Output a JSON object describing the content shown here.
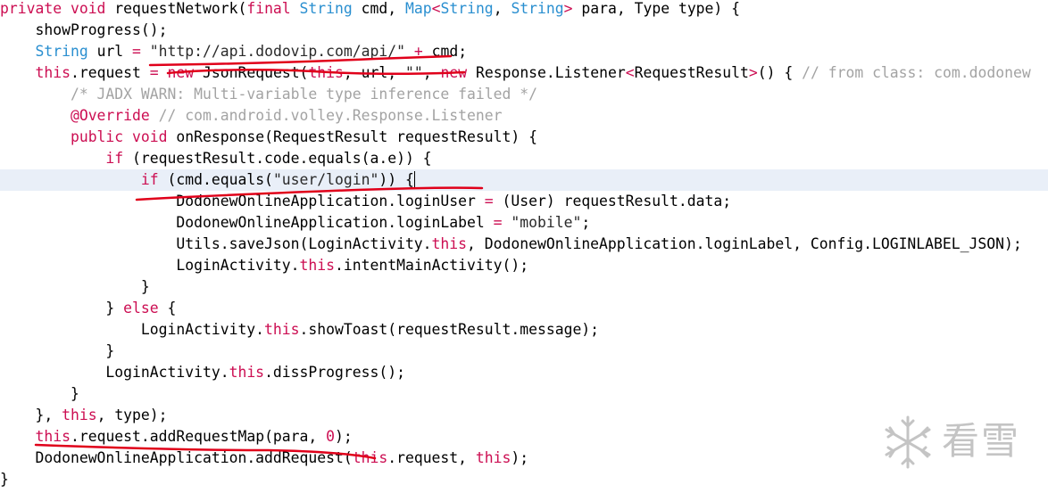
{
  "colors": {
    "keyword": "#cc0e52",
    "type": "#2a8fd0",
    "string": "#2a2a2a",
    "number": "#cc0e52",
    "comment": "#a3a3a3",
    "annotation": "#cc0e52",
    "plain": "#000000",
    "current_line_bg": "#e9eff8",
    "underline_red": "#e0001a"
  },
  "code": {
    "lines": [
      {
        "indent": "",
        "tokens": [
          {
            "t": "private",
            "c": "keyword"
          },
          {
            "t": " "
          },
          {
            "t": "void",
            "c": "keyword"
          },
          {
            "t": " requestNetwork("
          },
          {
            "t": "final",
            "c": "keyword"
          },
          {
            "t": " "
          },
          {
            "t": "String",
            "c": "type"
          },
          {
            "t": " cmd, "
          },
          {
            "t": "Map",
            "c": "type"
          },
          {
            "t": "<",
            "c": "keyword"
          },
          {
            "t": "String",
            "c": "type"
          },
          {
            "t": ", "
          },
          {
            "t": "String",
            "c": "type"
          },
          {
            "t": ">",
            "c": "keyword"
          },
          {
            "t": " para, Type type) {"
          }
        ]
      },
      {
        "indent": "    ",
        "tokens": [
          {
            "t": "showProgress();"
          }
        ]
      },
      {
        "indent": "    ",
        "tokens": [
          {
            "t": "String",
            "c": "type"
          },
          {
            "t": " url "
          },
          {
            "t": "=",
            "c": "keyword"
          },
          {
            "t": " "
          },
          {
            "t": "\"http://api.dodovip.com/api/\"",
            "c": "string"
          },
          {
            "t": " "
          },
          {
            "t": "+",
            "c": "keyword"
          },
          {
            "t": " cmd;"
          }
        ]
      },
      {
        "indent": "    ",
        "tokens": [
          {
            "t": "this",
            "c": "keyword"
          },
          {
            "t": ".request "
          },
          {
            "t": "=",
            "c": "keyword"
          },
          {
            "t": " "
          },
          {
            "t": "new",
            "c": "keyword"
          },
          {
            "t": " JsonRequest("
          },
          {
            "t": "this",
            "c": "keyword"
          },
          {
            "t": ", url, "
          },
          {
            "t": "\"\"",
            "c": "string"
          },
          {
            "t": ", "
          },
          {
            "t": "new",
            "c": "keyword"
          },
          {
            "t": " Response.Listener"
          },
          {
            "t": "<",
            "c": "keyword"
          },
          {
            "t": "RequestResult"
          },
          {
            "t": ">",
            "c": "keyword"
          },
          {
            "t": "() { "
          },
          {
            "t": "// from class: com.dodonew",
            "c": "comment"
          }
        ]
      },
      {
        "indent": "        ",
        "tokens": [
          {
            "t": "/* JADX WARN: Multi-variable type inference failed */",
            "c": "comment"
          }
        ]
      },
      {
        "indent": "        ",
        "tokens": [
          {
            "t": "@Override",
            "c": "annotation"
          },
          {
            "t": " "
          },
          {
            "t": "// com.android.volley.Response.Listener",
            "c": "comment"
          }
        ]
      },
      {
        "indent": "        ",
        "tokens": [
          {
            "t": "public",
            "c": "keyword"
          },
          {
            "t": " "
          },
          {
            "t": "void",
            "c": "keyword"
          },
          {
            "t": " onResponse(RequestResult requestResult) {"
          }
        ]
      },
      {
        "indent": "            ",
        "tokens": [
          {
            "t": "if",
            "c": "keyword"
          },
          {
            "t": " (requestResult.code.equals(a.e)) {"
          }
        ]
      },
      {
        "indent": "                ",
        "highlight": true,
        "cursor": true,
        "tokens": [
          {
            "t": "if",
            "c": "keyword"
          },
          {
            "t": " (cmd.equals("
          },
          {
            "t": "\"user/login\"",
            "c": "string"
          },
          {
            "t": ")) {"
          }
        ]
      },
      {
        "indent": "                    ",
        "tokens": [
          {
            "t": "DodonewOnlineApplication.loginUser "
          },
          {
            "t": "=",
            "c": "keyword"
          },
          {
            "t": " (User) requestResult.data;"
          }
        ]
      },
      {
        "indent": "                    ",
        "tokens": [
          {
            "t": "DodonewOnlineApplication.loginLabel "
          },
          {
            "t": "=",
            "c": "keyword"
          },
          {
            "t": " "
          },
          {
            "t": "\"mobile\"",
            "c": "string"
          },
          {
            "t": ";"
          }
        ]
      },
      {
        "indent": "                    ",
        "tokens": [
          {
            "t": "Utils.saveJson(LoginActivity."
          },
          {
            "t": "this",
            "c": "keyword"
          },
          {
            "t": ", DodonewOnlineApplication.loginLabel, Config.LOGINLABEL_JSON);"
          }
        ]
      },
      {
        "indent": "                    ",
        "tokens": [
          {
            "t": "LoginActivity."
          },
          {
            "t": "this",
            "c": "keyword"
          },
          {
            "t": ".intentMainActivity();"
          }
        ]
      },
      {
        "indent": "                ",
        "tokens": [
          {
            "t": "}"
          }
        ]
      },
      {
        "indent": "            ",
        "tokens": [
          {
            "t": "} "
          },
          {
            "t": "else",
            "c": "keyword"
          },
          {
            "t": " {"
          }
        ]
      },
      {
        "indent": "                ",
        "tokens": [
          {
            "t": "LoginActivity."
          },
          {
            "t": "this",
            "c": "keyword"
          },
          {
            "t": ".showToast(requestResult.message);"
          }
        ]
      },
      {
        "indent": "            ",
        "tokens": [
          {
            "t": "}"
          }
        ]
      },
      {
        "indent": "            ",
        "tokens": [
          {
            "t": "LoginActivity."
          },
          {
            "t": "this",
            "c": "keyword"
          },
          {
            "t": ".dissProgress();"
          }
        ]
      },
      {
        "indent": "        ",
        "tokens": [
          {
            "t": "}"
          }
        ]
      },
      {
        "indent": "    ",
        "tokens": [
          {
            "t": "}, "
          },
          {
            "t": "this",
            "c": "keyword"
          },
          {
            "t": ", type);"
          }
        ]
      },
      {
        "indent": "    ",
        "tokens": [
          {
            "t": "this",
            "c": "keyword"
          },
          {
            "t": ".request.addRequestMap(para, "
          },
          {
            "t": "0",
            "c": "number"
          },
          {
            "t": ");"
          }
        ]
      },
      {
        "indent": "    ",
        "tokens": [
          {
            "t": "DodonewOnlineApplication.addRequest("
          },
          {
            "t": "this",
            "c": "keyword"
          },
          {
            "t": ".request, "
          },
          {
            "t": "this",
            "c": "keyword"
          },
          {
            "t": ");"
          }
        ]
      },
      {
        "indent": "",
        "tokens": [
          {
            "t": "}"
          }
        ]
      }
    ]
  },
  "watermark": {
    "icon": "snowflake-icon",
    "text": "看雪"
  }
}
